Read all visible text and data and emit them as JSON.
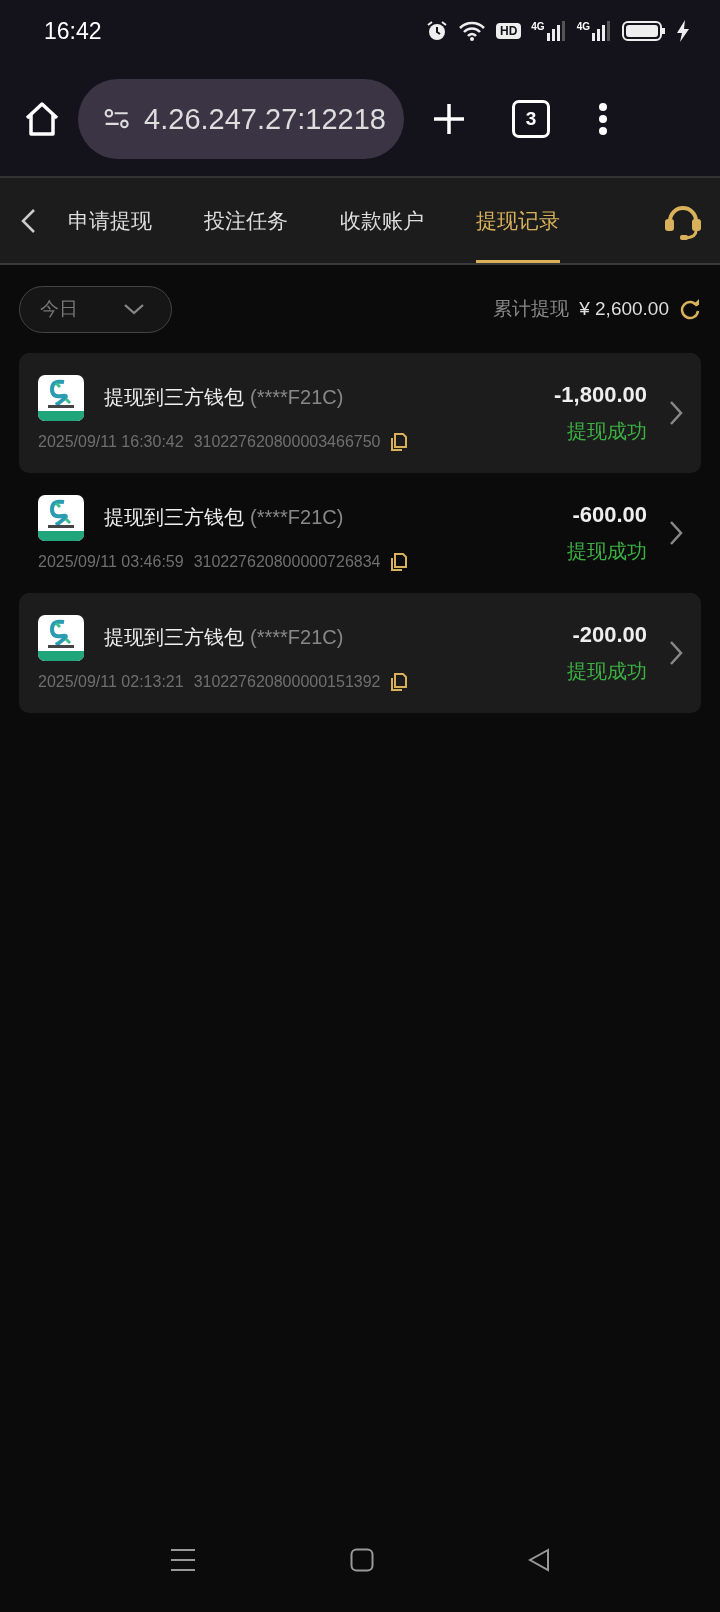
{
  "status_bar": {
    "time": "16:42",
    "hd_label": "HD",
    "signal_labels": [
      "4G",
      "4G"
    ]
  },
  "browser": {
    "url": "4.26.247.27:12218",
    "tab_count": "3"
  },
  "tabs": [
    {
      "label": "申请提现",
      "selected": false
    },
    {
      "label": "投注任务",
      "selected": false
    },
    {
      "label": "收款账户",
      "selected": false
    },
    {
      "label": "提现记录",
      "selected": true
    }
  ],
  "filter": {
    "period": "今日",
    "total_label": "累计提现",
    "total_amount": "¥ 2,600.00"
  },
  "records": [
    {
      "title": "提现到三方钱包",
      "account": "(****F21C)",
      "time": "2025/09/11 16:30:42",
      "order_no": "310227620800003466750",
      "amount": "-1,800.00",
      "status": "提现成功"
    },
    {
      "title": "提现到三方钱包",
      "account": "(****F21C)",
      "time": "2025/09/11 03:46:59",
      "order_no": "310227620800000726834",
      "amount": "-600.00",
      "status": "提现成功"
    },
    {
      "title": "提现到三方钱包",
      "account": "(****F21C)",
      "time": "2025/09/11 02:13:21",
      "order_no": "310227620800000151392",
      "amount": "-200.00",
      "status": "提现成功"
    }
  ]
}
